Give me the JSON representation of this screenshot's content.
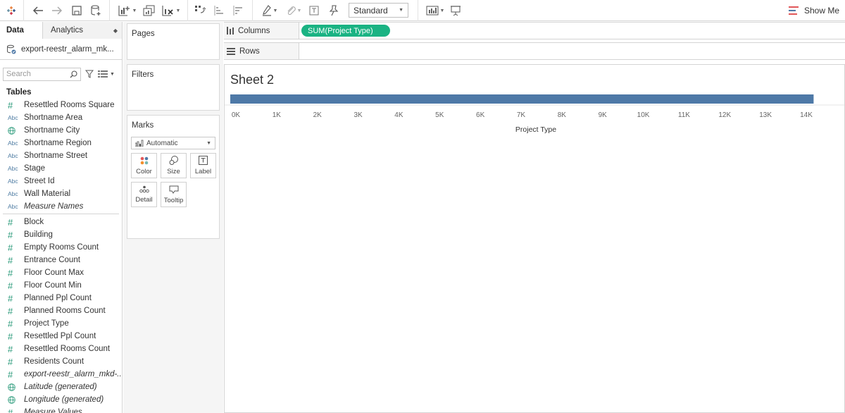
{
  "toolbar": {
    "view_size": "Standard",
    "show_me": "Show Me"
  },
  "left_pane": {
    "tabs": {
      "data": "Data",
      "analytics": "Analytics"
    },
    "datasource": "export-reestr_alarm_mk...",
    "search_placeholder": "Search",
    "tables_header": "Tables",
    "dimensions": [
      {
        "type": "num",
        "label": "Resettled Rooms Square",
        "italic": false
      },
      {
        "type": "abc",
        "label": "Shortname Area",
        "italic": false
      },
      {
        "type": "geo",
        "label": "Shortname City",
        "italic": false
      },
      {
        "type": "abc",
        "label": "Shortname Region",
        "italic": false
      },
      {
        "type": "abc",
        "label": "Shortname Street",
        "italic": false
      },
      {
        "type": "abc",
        "label": "Stage",
        "italic": false
      },
      {
        "type": "abc",
        "label": "Street Id",
        "italic": false
      },
      {
        "type": "abc",
        "label": "Wall Material",
        "italic": false
      },
      {
        "type": "abc",
        "label": "Measure Names",
        "italic": true
      }
    ],
    "measures": [
      {
        "type": "num",
        "label": "Block",
        "italic": false
      },
      {
        "type": "num",
        "label": "Building",
        "italic": false
      },
      {
        "type": "num",
        "label": "Empty Rooms Count",
        "italic": false
      },
      {
        "type": "num",
        "label": "Entrance Count",
        "italic": false
      },
      {
        "type": "num",
        "label": "Floor Count Max",
        "italic": false
      },
      {
        "type": "num",
        "label": "Floor Count Min",
        "italic": false
      },
      {
        "type": "num",
        "label": "Planned Ppl Count",
        "italic": false
      },
      {
        "type": "num",
        "label": "Planned Rooms Count",
        "italic": false
      },
      {
        "type": "num",
        "label": "Project Type",
        "italic": false
      },
      {
        "type": "num",
        "label": "Resettled Ppl Count",
        "italic": false
      },
      {
        "type": "num",
        "label": "Resettled Rooms Count",
        "italic": false
      },
      {
        "type": "num",
        "label": "Residents Count",
        "italic": false
      },
      {
        "type": "num",
        "label": "export-reestr_alarm_mkd-...",
        "italic": true
      },
      {
        "type": "geo",
        "label": "Latitude (generated)",
        "italic": true
      },
      {
        "type": "geo",
        "label": "Longitude (generated)",
        "italic": true
      },
      {
        "type": "num",
        "label": "Measure Values",
        "italic": true
      }
    ]
  },
  "cards": {
    "pages": "Pages",
    "filters": "Filters",
    "marks": "Marks",
    "mark_type": "Automatic",
    "mark_buttons": [
      "Color",
      "Size",
      "Label",
      "Detail",
      "Tooltip"
    ]
  },
  "shelves": {
    "columns_label": "Columns",
    "rows_label": "Rows",
    "columns_pill": "SUM(Project Type)"
  },
  "view": {
    "sheet_title": "Sheet 2"
  },
  "chart_data": {
    "type": "bar",
    "orientation": "horizontal",
    "categories": [
      ""
    ],
    "values": [
      14180
    ],
    "xlabel": "Project Type",
    "ylabel": "",
    "xlim": [
      0,
      14000
    ],
    "ticks": [
      "0K",
      "1K",
      "2K",
      "3K",
      "4K",
      "5K",
      "6K",
      "7K",
      "8K",
      "9K",
      "10K",
      "11K",
      "12K",
      "13K",
      "14K"
    ],
    "bar_color": "#4e79a7",
    "grid": false
  }
}
